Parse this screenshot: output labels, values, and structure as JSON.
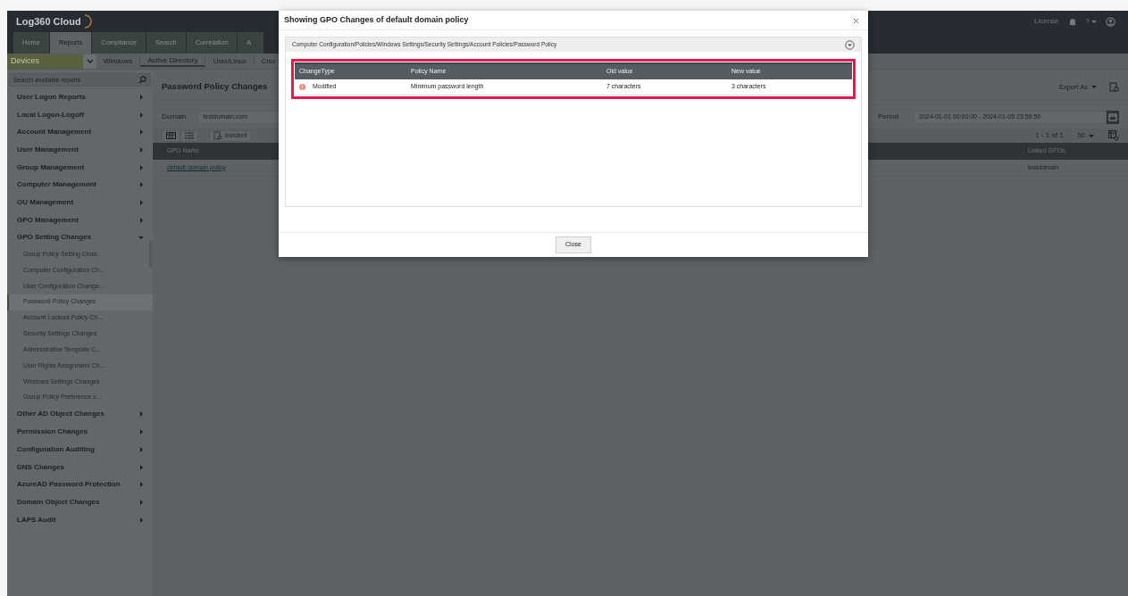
{
  "app": {
    "logo": "Log360 Cloud",
    "header_links": [
      "License"
    ],
    "help": "?",
    "tabs": [
      {
        "label": "Home",
        "selected": false
      },
      {
        "label": "Reports",
        "selected": true
      },
      {
        "label": "Compliance",
        "selected": false
      },
      {
        "label": "Search",
        "selected": false
      },
      {
        "label": "Correlation",
        "selected": false
      },
      {
        "label": "A",
        "selected": false
      }
    ],
    "category": "Devices",
    "subnav": [
      {
        "label": "Windows",
        "selected": false
      },
      {
        "label": "Active Directory",
        "selected": true
      },
      {
        "label": "Unix/Linux",
        "selected": false
      },
      {
        "label": "Cisc",
        "selected": false
      }
    ]
  },
  "sidebar": {
    "search": {
      "placeholder": "Search available reports"
    },
    "items": [
      {
        "label": "User Logon Reports",
        "expanded": false
      },
      {
        "label": "Local Logon-Logoff",
        "expanded": false
      },
      {
        "label": "Account Management",
        "expanded": false
      },
      {
        "label": "User Management",
        "expanded": false
      },
      {
        "label": "Group Management",
        "expanded": false
      },
      {
        "label": "Computer Management",
        "expanded": false
      },
      {
        "label": "OU Management",
        "expanded": false
      },
      {
        "label": "GPO Management",
        "expanded": false
      },
      {
        "label": "GPO Setting Changes",
        "expanded": true,
        "children": [
          {
            "label": "Group Policy Setting Chan...",
            "selected": false
          },
          {
            "label": "Computer Configuration Ch...",
            "selected": false
          },
          {
            "label": "User Configuration Change...",
            "selected": false
          },
          {
            "label": "Password Policy Changes",
            "selected": true
          },
          {
            "label": "Account Lockout Policy Ch...",
            "selected": false
          },
          {
            "label": "Security Settings Changes",
            "selected": false
          },
          {
            "label": "Administrative Template C...",
            "selected": false
          },
          {
            "label": "User Rights Assignment Ch...",
            "selected": false
          },
          {
            "label": "Windows Settings Changes",
            "selected": false
          },
          {
            "label": "Group Policy Preference c...",
            "selected": false
          }
        ]
      },
      {
        "label": "Other AD Object Changes",
        "expanded": false
      },
      {
        "label": "Permission Changes",
        "expanded": false
      },
      {
        "label": "Configuration Auditing",
        "expanded": false
      },
      {
        "label": "DNS Changes",
        "expanded": false
      },
      {
        "label": "AzureAD Password Protection",
        "expanded": false
      },
      {
        "label": "Domain Object Changes",
        "expanded": false
      },
      {
        "label": "LAPS Audit",
        "expanded": false
      }
    ]
  },
  "report": {
    "title": "Password Policy Changes",
    "export": "Export As",
    "domain_label": "Domain",
    "domain_value": "testdomain.com",
    "period_label": "Period",
    "period_value": "2024-01-01 00:00:00 - 2024-01-05 23:59:59",
    "incident": "Incident",
    "pagination": "1 - 1 of 1",
    "page_size": "50",
    "table": {
      "columns": [
        "GPO Name",
        "Linked GPOs"
      ],
      "rows": [
        [
          "default domain policy",
          "testdomain"
        ]
      ]
    }
  },
  "modal": {
    "title": "Showing GPO Changes of default domain policy",
    "path": "Computer Configuration/Policies/Windows Settings/Security Settings/Account Policies/Password Policy",
    "columns": [
      "ChangeType",
      "Policy Name",
      "Old value",
      "New value"
    ],
    "rows": [
      {
        "kind": "modified",
        "cells": [
          "Modified",
          "Minimum password length",
          "7 characters",
          "3 characters"
        ]
      }
    ],
    "button": "Close"
  }
}
